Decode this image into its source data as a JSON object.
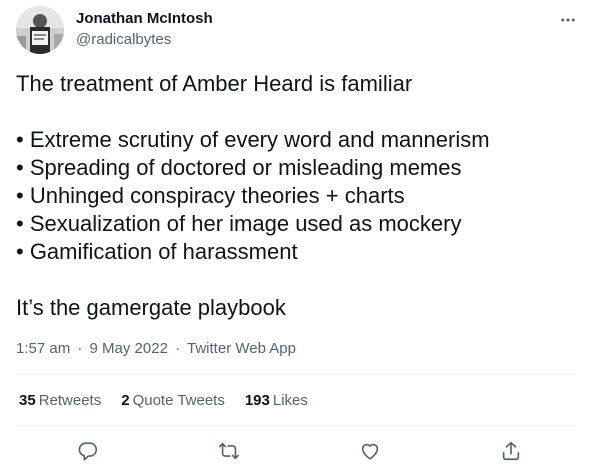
{
  "author": {
    "name": "Jonathan McIntosh",
    "handle": "@radicalbytes"
  },
  "tweet": {
    "intro": "The treatment of Amber Heard is familiar",
    "bullets": [
      "• Extreme scrutiny of every word and mannerism",
      "• Spreading of doctored or misleading memes",
      "• Unhinged conspiracy theories + charts",
      "• Sexualization of her image used as mockery",
      "• Gamification of harassment"
    ],
    "closing": "It’s the gamergate playbook"
  },
  "meta": {
    "time": "1:57 am",
    "separator": "·",
    "date": "9 May 2022",
    "source": "Twitter Web App"
  },
  "stats": {
    "retweets": {
      "count": "35",
      "label": "Retweets"
    },
    "quotes": {
      "count": "2",
      "label": "Quote Tweets"
    },
    "likes": {
      "count": "193",
      "label": "Likes"
    }
  },
  "icons": {
    "more": "more-icon",
    "reply": "reply-icon",
    "retweet": "retweet-icon",
    "like": "like-icon",
    "share": "share-icon"
  },
  "colors": {
    "text": "#0f1419",
    "secondary": "#536471",
    "divider": "#eff3f4"
  }
}
